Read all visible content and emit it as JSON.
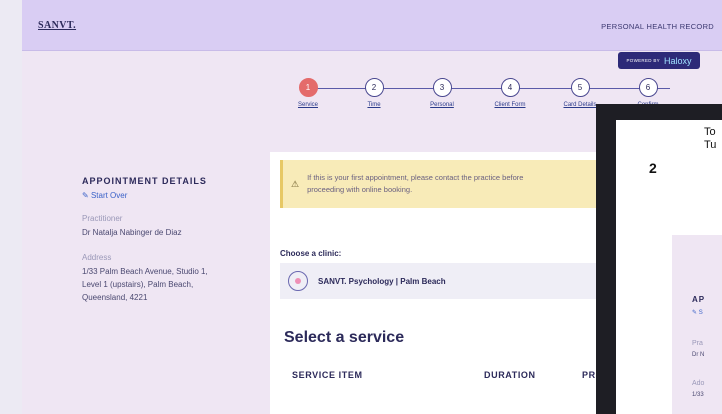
{
  "header": {
    "logo": "SANVT.",
    "right_label": "PERSONAL HEALTH RECORD"
  },
  "powered": {
    "prefix": "POWERED BY",
    "brand": "Haloxy"
  },
  "stepper": {
    "steps": [
      {
        "num": "1",
        "label": "Service"
      },
      {
        "num": "2",
        "label": "Time"
      },
      {
        "num": "3",
        "label": "Personal"
      },
      {
        "num": "4",
        "label": "Client Form"
      },
      {
        "num": "5",
        "label": "Card Details"
      },
      {
        "num": "6",
        "label": "Confirm"
      }
    ],
    "active_step": 1
  },
  "details": {
    "title": "APPOINTMENT DETAILS",
    "start_over": "Start Over",
    "practitioner_label": "Practitioner",
    "practitioner": "Dr Natalja Nabinger de Diaz",
    "address_label": "Address",
    "address_lines": [
      "1/33 Palm Beach Avenue, Studio 1,",
      "Level 1 (upstairs), Palm Beach,",
      "Queensland, 4221"
    ]
  },
  "alert": {
    "icon": "warning-icon",
    "lines": [
      "If this is your first appointment, please contact the practice before",
      "proceeding with online booking."
    ]
  },
  "clinic": {
    "choose_label": "Choose a clinic:",
    "name": "SANVT. Psychology | Palm Beach"
  },
  "service": {
    "title": "Select a service",
    "columns": [
      "SERVICE ITEM",
      "DURATION",
      "PRICE"
    ]
  },
  "overlay": {
    "num": "2",
    "text_lines": [
      "To",
      "Tu"
    ],
    "details_title": "AP",
    "start": "S",
    "pract_label": "Pra",
    "pract_val": "Dr N",
    "addr_label": "Ado",
    "addr_val": "1/33"
  },
  "colors": {
    "header": "#d9cdf3",
    "page": "#efe6f3",
    "active_step": "#e46b6b",
    "accent": "#2c2a5a",
    "powered_bg": "#2d2a78"
  }
}
